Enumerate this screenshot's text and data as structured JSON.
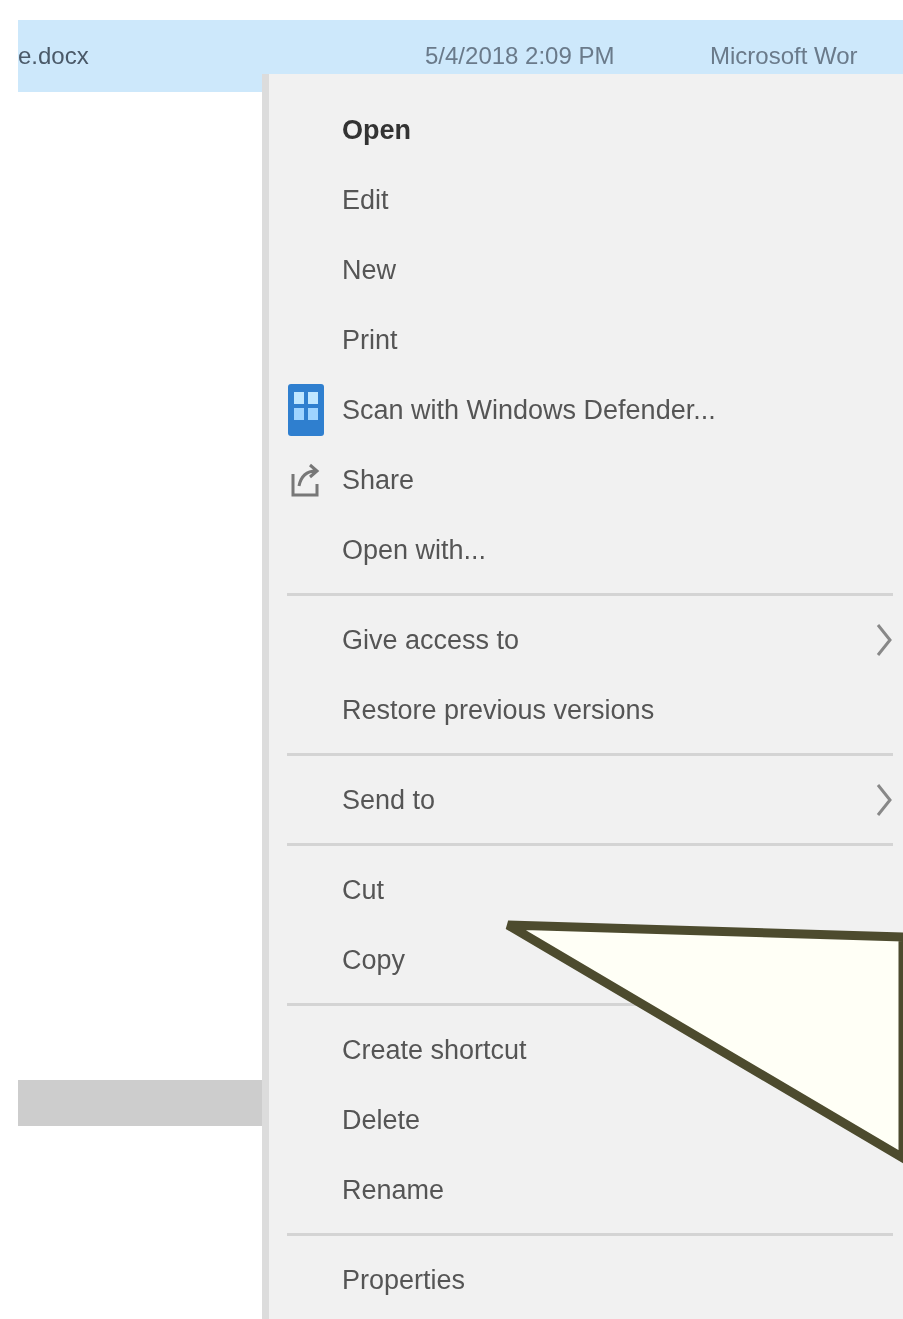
{
  "file_row": {
    "name": "e.docx",
    "date": "5/4/2018 2:09 PM",
    "type": "Microsoft Wor",
    "selected": true
  },
  "context_menu": {
    "items": [
      {
        "kind": "item",
        "label": "Open",
        "default": true
      },
      {
        "kind": "item",
        "label": "Edit",
        "default": false
      },
      {
        "kind": "item",
        "label": "New",
        "default": false
      },
      {
        "kind": "item",
        "label": "Print",
        "default": false
      },
      {
        "kind": "scan",
        "label": "Scan with Windows Defender...",
        "default": false
      },
      {
        "kind": "share",
        "label": "Share",
        "default": false
      },
      {
        "kind": "item",
        "label": "Open with...",
        "default": false
      },
      {
        "kind": "separator"
      },
      {
        "kind": "item",
        "label": "Give access to",
        "default": false,
        "submenu": true
      },
      {
        "kind": "item",
        "label": "Restore previous versions",
        "default": false
      },
      {
        "kind": "separator"
      },
      {
        "kind": "item",
        "label": "Send to",
        "default": false,
        "submenu": true
      },
      {
        "kind": "separator"
      },
      {
        "kind": "item",
        "label": "Cut",
        "default": false
      },
      {
        "kind": "item",
        "label": "Copy",
        "default": false
      },
      {
        "kind": "separator"
      },
      {
        "kind": "item",
        "label": "Create shortcut",
        "default": false
      },
      {
        "kind": "item",
        "label": "Delete",
        "default": false
      },
      {
        "kind": "item",
        "label": "Rename",
        "default": false
      },
      {
        "kind": "separator"
      },
      {
        "kind": "item",
        "label": "Properties",
        "default": false
      }
    ]
  }
}
